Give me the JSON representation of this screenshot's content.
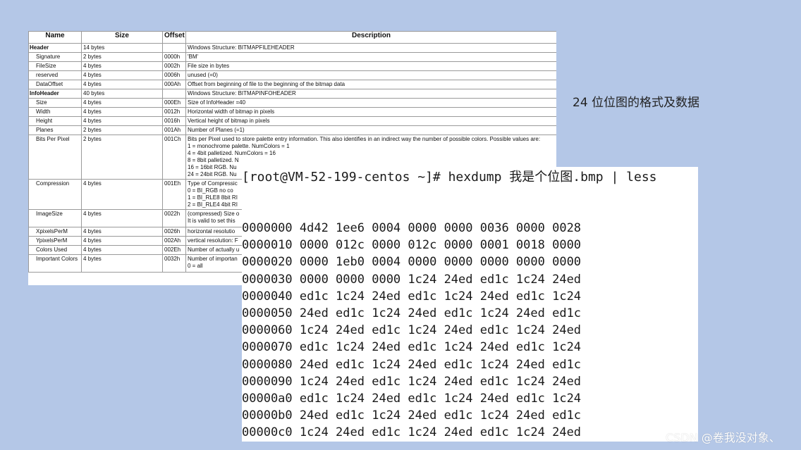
{
  "table": {
    "headers": [
      "Name",
      "Size",
      "Offset",
      "Description"
    ],
    "rows": [
      {
        "name": "Header",
        "size": "14 bytes",
        "offset": "",
        "desc": "Windows Structure: BITMAPFILEHEADER",
        "group": true
      },
      {
        "name": "Signature",
        "size": "2 bytes",
        "offset": "0000h",
        "desc": "'BM'"
      },
      {
        "name": "FileSize",
        "size": "4 bytes",
        "offset": "0002h",
        "desc": "File size in bytes"
      },
      {
        "name": "reserved",
        "size": "4 bytes",
        "offset": "0006h",
        "desc": "unused (=0)"
      },
      {
        "name": "DataOffset",
        "size": "4 bytes",
        "offset": "000Ah",
        "desc": "Offset from beginning of file to the beginning of the bitmap data"
      },
      {
        "name": "InfoHeader",
        "size": "40 bytes",
        "offset": "",
        "desc": "Windows Structure: BITMAPINFOHEADER",
        "group": true
      },
      {
        "name": "Size",
        "size": "4 bytes",
        "offset": "000Eh",
        "desc": "Size of InfoHeader =40"
      },
      {
        "name": "Width",
        "size": "4 bytes",
        "offset": "0012h",
        "desc": "Horizontal width of bitmap in pixels"
      },
      {
        "name": "Height",
        "size": "4 bytes",
        "offset": "0016h",
        "desc": "Vertical height of bitmap in pixels"
      },
      {
        "name": "Planes",
        "size": "2 bytes",
        "offset": "001Ah",
        "desc": "Number of Planes (=1)"
      },
      {
        "name": "Bits Per Pixel",
        "size": "2 bytes",
        "offset": "001Ch",
        "desc": "Bits per Pixel used to store palette entry information. This also identifies in an indirect way the number of possible colors. Possible values are:\n1 = monochrome palette. NumColors = 1\n4 = 4bit palletized. NumColors = 16\n8 = 8bit palletized. N\n16 = 16bit RGB. Nu\n24 = 24bit RGB. Nu",
        "tall": 60
      },
      {
        "name": "Compression",
        "size": "4 bytes",
        "offset": "001Eh",
        "desc": "Type of Compressic\n0 = BI_RGB   no co\n1 = BI_RLE8 8bit RI\n2 = BI_RLE4 4bit RI",
        "tall": 40
      },
      {
        "name": "ImageSize",
        "size": "4 bytes",
        "offset": "0022h",
        "desc": "(compressed) Size o\nIt is valid to set this",
        "tall": 22
      },
      {
        "name": "XpixelsPerM",
        "size": "4 bytes",
        "offset": "0026h",
        "desc": "horizontal resolutio"
      },
      {
        "name": "YpixelsPerM",
        "size": "4 bytes",
        "offset": "002Ah",
        "desc": "vertical resolution: F"
      },
      {
        "name": "Colors Used",
        "size": "4 bytes",
        "offset": "002Eh",
        "desc": "Number of actually u"
      },
      {
        "name": "Important Colors",
        "size": "4 bytes",
        "offset": "0032h",
        "desc": "Number of importan\n0 = all",
        "tall": 22
      }
    ]
  },
  "caption": "24 位位图的格式及数据",
  "terminal": {
    "command": "[root@VM-52-199-centos ~]# hexdump 我是个位图.bmp | less",
    "lines": [
      "0000000 4d42 1ee6 0004 0000 0000 0036 0000 0028",
      "0000010 0000 012c 0000 012c 0000 0001 0018 0000",
      "0000020 0000 1eb0 0004 0000 0000 0000 0000 0000",
      "0000030 0000 0000 0000 1c24 24ed ed1c 1c24 24ed",
      "0000040 ed1c 1c24 24ed ed1c 1c24 24ed ed1c 1c24",
      "0000050 24ed ed1c 1c24 24ed ed1c 1c24 24ed ed1c",
      "0000060 1c24 24ed ed1c 1c24 24ed ed1c 1c24 24ed",
      "0000070 ed1c 1c24 24ed ed1c 1c24 24ed ed1c 1c24",
      "0000080 24ed ed1c 1c24 24ed ed1c 1c24 24ed ed1c",
      "0000090 1c24 24ed ed1c 1c24 24ed ed1c 1c24 24ed",
      "00000a0 ed1c 1c24 24ed ed1c 1c24 24ed ed1c 1c24",
      "00000b0 24ed ed1c 1c24 24ed ed1c 1c24 24ed ed1c",
      "00000c0 1c24 24ed ed1c 1c24 24ed ed1c 1c24 24ed"
    ]
  },
  "watermark": "CSDN @卷我没对象、"
}
